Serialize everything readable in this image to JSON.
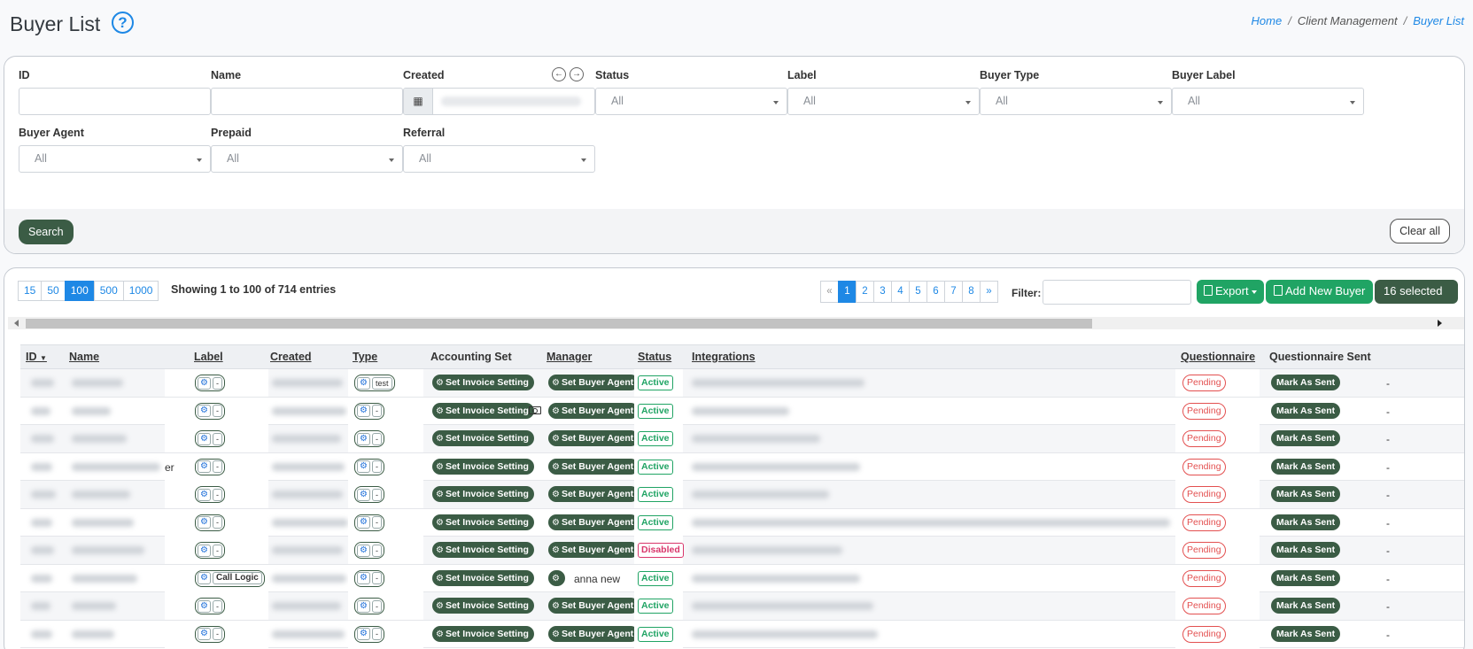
{
  "page": {
    "title": "Buyer List",
    "help_icon": "?",
    "breadcrumb": [
      "Home",
      "Client Management",
      "Buyer List"
    ]
  },
  "filters": {
    "id_label": "ID",
    "name_label": "Name",
    "created_label": "Created",
    "status_label": "Status",
    "label_label": "Label",
    "buyer_type_label": "Buyer Type",
    "buyer_label_label": "Buyer Label",
    "buyer_agent_label": "Buyer Agent",
    "prepaid_label": "Prepaid",
    "referral_label": "Referral",
    "select_placeholder": "All",
    "search_button": "Search",
    "clear_button": "Clear all"
  },
  "list": {
    "page_sizes": [
      "15",
      "50",
      "100",
      "500",
      "1000"
    ],
    "active_page_size": "100",
    "showing": "Showing 1 to 100 of 714 entries",
    "pager": [
      "«",
      "1",
      "2",
      "3",
      "4",
      "5",
      "6",
      "7",
      "8",
      "»"
    ],
    "active_page": "1",
    "filter_label": "Filter:",
    "export_label": "Export",
    "add_label": "Add New Buyer",
    "selected_label": "16 selected"
  },
  "table": {
    "headers": [
      "ID",
      "Name",
      "Label",
      "Created",
      "Type",
      "Accounting Set",
      "Manager",
      "Status",
      "Integrations",
      "Questionnaire",
      "Questionnaire Sent"
    ],
    "set_invoice": "Set Invoice Setting",
    "set_agent": "Set Buyer Agent",
    "pending": "Pending",
    "mark_sent": "Mark As Sent",
    "dash": "-",
    "rows": [
      {
        "label": "-",
        "type": "test",
        "manager": "Set Buyer Agent",
        "status": "Active",
        "name_suffix": ""
      },
      {
        "label": "-",
        "type": "-",
        "manager": "Set Buyer Agent",
        "status": "Active",
        "name_suffix": ""
      },
      {
        "label": "-",
        "type": "-",
        "manager": "Set Buyer Agent",
        "status": "Active",
        "name_suffix": ""
      },
      {
        "label": "-",
        "type": "-",
        "manager": "Set Buyer Agent",
        "status": "Active",
        "name_suffix": "er"
      },
      {
        "label": "-",
        "type": "-",
        "manager": "Set Buyer Agent",
        "status": "Active",
        "name_suffix": ""
      },
      {
        "label": "-",
        "type": "-",
        "manager": "Set Buyer Agent",
        "status": "Active",
        "name_suffix": ""
      },
      {
        "label": "-",
        "type": "-",
        "manager": "Set Buyer Agent",
        "status": "Disabled",
        "name_suffix": ""
      },
      {
        "label": "Call Logic",
        "type": "-",
        "manager": "anna new",
        "status": "Active",
        "name_suffix": ""
      },
      {
        "label": "-",
        "type": "-",
        "manager": "Set Buyer Agent",
        "status": "Active",
        "name_suffix": ""
      },
      {
        "label": "-",
        "type": "-",
        "manager": "Set Buyer Agent",
        "status": "Active",
        "name_suffix": ""
      }
    ]
  }
}
